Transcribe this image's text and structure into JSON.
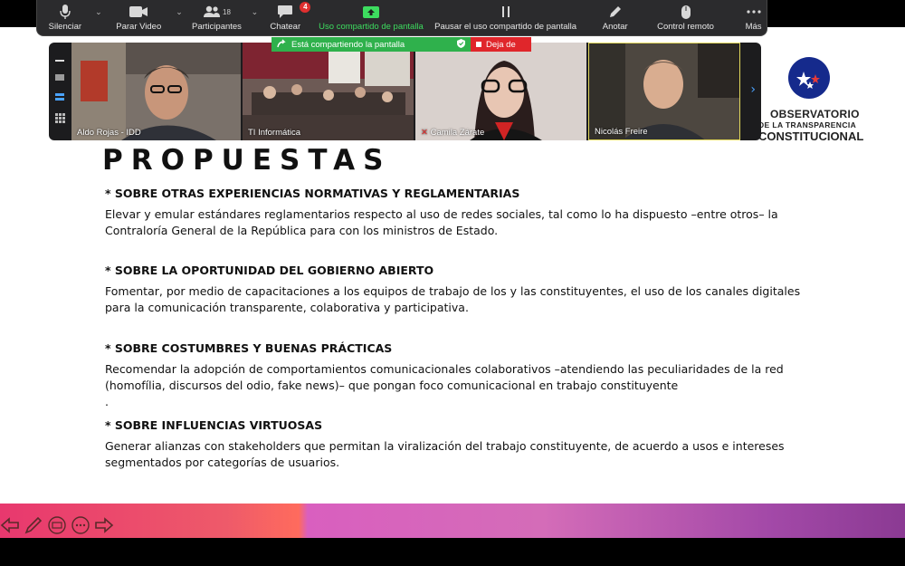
{
  "toolbar": {
    "items": [
      {
        "label": "Silenciar",
        "icon": "microphone-icon"
      },
      {
        "label": "Parar Video",
        "icon": "video-camera-icon"
      },
      {
        "label": "Participantes",
        "icon": "participants-icon",
        "count": "18"
      },
      {
        "label": "Chatear",
        "icon": "chat-icon",
        "badge": "4"
      },
      {
        "label": "Uso compartido de pantalla",
        "icon": "share-screen-icon"
      },
      {
        "label": "Pausar el uso compartido de pantalla",
        "icon": "pause-icon"
      },
      {
        "label": "Anotar",
        "icon": "pencil-icon"
      },
      {
        "label": "Control remoto",
        "icon": "mouse-icon"
      },
      {
        "label": "Más",
        "icon": "more-icon"
      }
    ]
  },
  "share_banner": {
    "status": "Está compartiendo la pantalla",
    "stop": "Deja de",
    "green": "#2fb14c",
    "red": "#e0262b"
  },
  "participants": [
    {
      "name": "Aldo Rojas - IDD"
    },
    {
      "name": "TI Informática"
    },
    {
      "name": "Camila Zárate"
    },
    {
      "name": "Nicolás Freire"
    }
  ],
  "logo": {
    "line1": "OBSERVATORIO",
    "line2": "DE LA TRANSPARENCIA",
    "line3": "CONSTITUCIONAL"
  },
  "slide": {
    "title": "PROPUESTAS",
    "sections": [
      {
        "heading": "* SOBRE OTRAS EXPERIENCIAS NORMATIVAS Y REGLAMENTARIAS",
        "body": "Elevar y emular estándares reglamentarios respecto al uso de redes sociales, tal como lo ha dispuesto –entre otros– la Contraloría General de la República para con los ministros de Estado."
      },
      {
        "heading": "* SOBRE LA OPORTUNIDAD DEL GOBIERNO ABIERTO",
        "body": "Fomentar, por medio de capacitaciones a los equipos de trabajo de los y las constituyentes, el uso de los canales digitales para la comunicación transparente, colaborativa y participativa."
      },
      {
        "heading": "* SOBRE COSTUMBRES Y BUENAS PRÁCTICAS",
        "body": "Recomendar la adopción de comportamientos comunicacionales colaborativos –atendiendo las peculiaridades de la red (homofília, discursos del odio, fake news)– que pongan foco comunicacional en trabajo constituyente",
        "trailing": "."
      },
      {
        "heading": "* SOBRE INFLUENCIAS VIRTUOSAS",
        "body": "Generar alianzas con stakeholders que permitan la viralización del trabajo constituyente, de acuerdo a usos e intereses segmentados por categorías de usuarios."
      }
    ]
  },
  "slide_nav": {
    "icons": [
      "arrow-left-icon",
      "pen-icon",
      "slides-icon",
      "more-options-icon",
      "arrow-right-icon"
    ]
  }
}
